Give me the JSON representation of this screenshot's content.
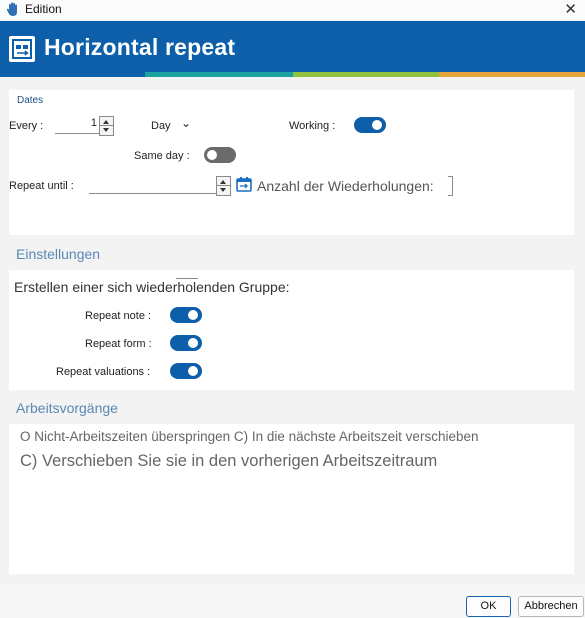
{
  "window": {
    "title": "Edition",
    "close_glyph": "✕"
  },
  "header": {
    "title": "Horizontal repeat",
    "icon": "calendar-repeat-icon",
    "color": "#0c5fa8",
    "accent_colors": [
      "#1aa3a0",
      "#8fc13e",
      "#e8a43c"
    ]
  },
  "dates": {
    "section_label": "Dates",
    "every_label": "Every :",
    "every_value": "1",
    "unit_value": "Day",
    "unit_chevron": "⌄",
    "working_label": "Working :",
    "working_on": true,
    "same_day_label": "Same day :",
    "same_day_on": false,
    "repeat_until_label": "Repeat until :",
    "repeat_until_value": "",
    "count_label": "Anzahl der Wiederholungen:"
  },
  "settings": {
    "section_label": "Einstellungen",
    "intro": "Erstellen einer sich wiederholenden Gruppe:",
    "toggles": [
      {
        "label": "Repeat note :",
        "on": true
      },
      {
        "label": "Repeat form :",
        "on": true
      },
      {
        "label": "Repeat valuations :",
        "on": true
      }
    ]
  },
  "workflow": {
    "section_label": "Arbeitsvorgänge",
    "line1": "O Nicht-Arbeitszeiten überspringen C) In die nächste Arbeitszeit verschieben",
    "line2": "C) Verschieben Sie sie in den vorherigen Arbeitszeitraum"
  },
  "footer": {
    "ok_label": "OK",
    "cancel_label": "Abbrechen"
  }
}
